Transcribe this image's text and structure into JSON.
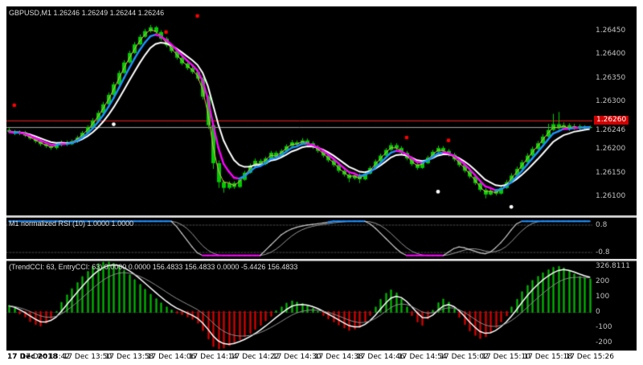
{
  "window": {
    "background": "#FFFFFF"
  },
  "main_chart": {
    "symbol_label": "GBPUSD,M1",
    "ohlc_readout": "1.26246 1.26249 1.26244 1.26246",
    "price_axis_labels": [
      "1.26450",
      "1.26400",
      "1.26350",
      "1.26300",
      "1.26200",
      "1.26150",
      "1.26100"
    ],
    "ask_badge": "1.26260",
    "bid_label": "1.26246"
  },
  "rsi_panel": {
    "label": "M1 normalized RSI (10) 1.0000 1.0000",
    "axis_labels": [
      "0.8",
      "-0.8"
    ]
  },
  "cci_panel": {
    "label": "(TrendCCI: 63, EntryCCI: 63) 0.0000 0.0000 156.4833 156.4833 0.0000 -5.4426 156.4833",
    "axis_labels": [
      "326.8111",
      "200",
      "100",
      "0",
      "-100",
      "-200"
    ]
  },
  "time_axis_labels": [
    "17 Dec 2018",
    "17 Dec 13:42",
    "17 Dec 13:50",
    "17 Dec 13:58",
    "17 Dec 14:06",
    "17 Dec 14:14",
    "17 Dec 14:22",
    "17 Dec 14:30",
    "17 Dec 14:38",
    "17 Dec 14:46",
    "17 Dec 14:54",
    "17 Dec 15:02",
    "17 Dec 15:10",
    "17 Dec 15:18",
    "17 Dec 15:26"
  ],
  "colors": {
    "background": "#000000",
    "axis_text": "#C0C0C0",
    "candle": "#00CC00",
    "ma_white": "#FFFFFF",
    "ma_trend_up": "#1E90FF",
    "ma_trend_down": "#FF00FF",
    "ma_fast_gold": "#F0B060",
    "red_line": "#FF2020",
    "bid_line": "#AAAAAA",
    "badge_bg": "#D00000",
    "signal_red": "#FF0000",
    "signal_white": "#FFFFFF",
    "rsi_high": "#1E90FF",
    "rsi_low": "#FF00FF",
    "rsi_mid": "#C8C8C8",
    "cci_positive": "#00B000",
    "cci_negative": "#D00000",
    "cci_line_white": "#FFFFFF",
    "cci_line_silver": "#909090"
  },
  "chart_data": [
    {
      "type": "candlestick",
      "title": "GBPUSD,M1",
      "ylim": [
        1.2606,
        1.265
      ],
      "red_line_price": 1.2626,
      "bid_price": 1.26246,
      "current_bar": {
        "open": 1.26246,
        "high": 1.26249,
        "low": 1.26244,
        "close": 1.26246
      },
      "label_indices": [
        7,
        15,
        23,
        31,
        39,
        47,
        55,
        63,
        71,
        79,
        87,
        95,
        103,
        111
      ],
      "signals": {
        "red": [
          {
            "i": 1,
            "price": 1.26292
          },
          {
            "i": 30,
            "price": 1.26446
          },
          {
            "i": 36,
            "price": 1.2648
          },
          {
            "i": 76,
            "price": 1.26224
          },
          {
            "i": 84,
            "price": 1.26218
          }
        ],
        "white": [
          {
            "i": 20,
            "price": 1.26252
          },
          {
            "i": 82,
            "price": 1.2611
          },
          {
            "i": 96,
            "price": 1.26078
          }
        ]
      },
      "ohlc": [
        [
          1.2624,
          1.26244,
          1.26233,
          1.26236
        ],
        [
          1.26236,
          1.2624,
          1.26229,
          1.26232
        ],
        [
          1.26232,
          1.26239,
          1.26229,
          1.26235
        ],
        [
          1.26235,
          1.26238,
          1.26225,
          1.26228
        ],
        [
          1.26228,
          1.26232,
          1.26219,
          1.26222
        ],
        [
          1.26222,
          1.26226,
          1.26212,
          1.26216
        ],
        [
          1.26216,
          1.2622,
          1.26206,
          1.2621
        ],
        [
          1.2621,
          1.26215,
          1.26202,
          1.26206
        ],
        [
          1.26206,
          1.2621,
          1.26198,
          1.26202
        ],
        [
          1.26202,
          1.26212,
          1.26199,
          1.26208
        ],
        [
          1.26208,
          1.26218,
          1.26205,
          1.26214
        ],
        [
          1.26214,
          1.26218,
          1.26206,
          1.2621
        ],
        [
          1.2621,
          1.2622,
          1.26208,
          1.26216
        ],
        [
          1.26216,
          1.26228,
          1.26213,
          1.26224
        ],
        [
          1.26224,
          1.26238,
          1.26222,
          1.26234
        ],
        [
          1.26234,
          1.2625,
          1.26232,
          1.26246
        ],
        [
          1.26246,
          1.26265,
          1.26244,
          1.2626
        ],
        [
          1.2626,
          1.26281,
          1.26258,
          1.26276
        ],
        [
          1.26276,
          1.26299,
          1.26274,
          1.26294
        ],
        [
          1.26294,
          1.26319,
          1.26292,
          1.26314
        ],
        [
          1.26314,
          1.26341,
          1.26312,
          1.26336
        ],
        [
          1.26336,
          1.26365,
          1.26334,
          1.2636
        ],
        [
          1.2636,
          1.26387,
          1.26358,
          1.26382
        ],
        [
          1.26382,
          1.26407,
          1.2638,
          1.26402
        ],
        [
          1.26402,
          1.26425,
          1.264,
          1.2642
        ],
        [
          1.2642,
          1.26441,
          1.26418,
          1.26436
        ],
        [
          1.26436,
          1.26453,
          1.26434,
          1.26448
        ],
        [
          1.26448,
          1.26461,
          1.26445,
          1.26456
        ],
        [
          1.26456,
          1.26459,
          1.26442,
          1.26446
        ],
        [
          1.26446,
          1.2645,
          1.26428,
          1.26432
        ],
        [
          1.26432,
          1.26436,
          1.26414,
          1.26418
        ],
        [
          1.26418,
          1.26422,
          1.26402,
          1.26406
        ],
        [
          1.26406,
          1.2641,
          1.26388,
          1.26392
        ],
        [
          1.26392,
          1.26396,
          1.26376,
          1.2638
        ],
        [
          1.2638,
          1.26385,
          1.26366,
          1.2637
        ],
        [
          1.2637,
          1.26374,
          1.26358,
          1.26362
        ],
        [
          1.26362,
          1.26366,
          1.26344,
          1.26348
        ],
        [
          1.26348,
          1.26351,
          1.26304,
          1.2631
        ],
        [
          1.2631,
          1.26313,
          1.26242,
          1.2625
        ],
        [
          1.2625,
          1.26254,
          1.26158,
          1.2617
        ],
        [
          1.2617,
          1.26176,
          1.26118,
          1.2613
        ],
        [
          1.2613,
          1.26134,
          1.26108,
          1.26118
        ],
        [
          1.26118,
          1.26132,
          1.26115,
          1.26128
        ],
        [
          1.26128,
          1.26132,
          1.26116,
          1.2612
        ],
        [
          1.2612,
          1.26139,
          1.26118,
          1.26135
        ],
        [
          1.26135,
          1.26154,
          1.26133,
          1.2615
        ],
        [
          1.2615,
          1.26169,
          1.26148,
          1.26165
        ],
        [
          1.26165,
          1.2618,
          1.26162,
          1.26175
        ],
        [
          1.26175,
          1.26179,
          1.26164,
          1.26168
        ],
        [
          1.26168,
          1.26184,
          1.26166,
          1.2618
        ],
        [
          1.2618,
          1.26196,
          1.26178,
          1.26192
        ],
        [
          1.26192,
          1.26196,
          1.2618,
          1.26184
        ],
        [
          1.26184,
          1.262,
          1.26182,
          1.26196
        ],
        [
          1.26196,
          1.2621,
          1.26194,
          1.26206
        ],
        [
          1.26206,
          1.26219,
          1.26204,
          1.26214
        ],
        [
          1.26214,
          1.26218,
          1.26206,
          1.2621
        ],
        [
          1.2621,
          1.26223,
          1.26208,
          1.26218
        ],
        [
          1.26218,
          1.26222,
          1.26208,
          1.26212
        ],
        [
          1.26212,
          1.26216,
          1.262,
          1.26204
        ],
        [
          1.26204,
          1.26208,
          1.26192,
          1.26196
        ],
        [
          1.26196,
          1.262,
          1.26182,
          1.26186
        ],
        [
          1.26186,
          1.2619,
          1.26172,
          1.26176
        ],
        [
          1.26176,
          1.2618,
          1.26162,
          1.26166
        ],
        [
          1.26166,
          1.2617,
          1.2615,
          1.26154
        ],
        [
          1.26154,
          1.26158,
          1.26142,
          1.26146
        ],
        [
          1.26146,
          1.2615,
          1.2613,
          1.26138
        ],
        [
          1.26138,
          1.26149,
          1.26135,
          1.26144
        ],
        [
          1.26144,
          1.26148,
          1.26128,
          1.26136
        ],
        [
          1.26136,
          1.26152,
          1.26134,
          1.26148
        ],
        [
          1.26148,
          1.26164,
          1.26146,
          1.2616
        ],
        [
          1.2616,
          1.26178,
          1.26158,
          1.26174
        ],
        [
          1.26174,
          1.2619,
          1.26172,
          1.26186
        ],
        [
          1.26186,
          1.26202,
          1.26184,
          1.26198
        ],
        [
          1.26198,
          1.26213,
          1.26196,
          1.26208
        ],
        [
          1.26208,
          1.26212,
          1.26198,
          1.26202
        ],
        [
          1.26202,
          1.26206,
          1.26188,
          1.26192
        ],
        [
          1.26192,
          1.26196,
          1.26176,
          1.2618
        ],
        [
          1.2618,
          1.26184,
          1.26164,
          1.26168
        ],
        [
          1.26168,
          1.26172,
          1.26156,
          1.2616
        ],
        [
          1.2616,
          1.26174,
          1.26158,
          1.2617
        ],
        [
          1.2617,
          1.26186,
          1.26168,
          1.26182
        ],
        [
          1.26182,
          1.26198,
          1.2618,
          1.26194
        ],
        [
          1.26194,
          1.26207,
          1.26192,
          1.26202
        ],
        [
          1.26202,
          1.26206,
          1.26192,
          1.26196
        ],
        [
          1.26196,
          1.262,
          1.26184,
          1.26188
        ],
        [
          1.26188,
          1.26192,
          1.26174,
          1.26178
        ],
        [
          1.26178,
          1.26182,
          1.26162,
          1.26166
        ],
        [
          1.26166,
          1.2617,
          1.2615,
          1.26154
        ],
        [
          1.26154,
          1.26158,
          1.26138,
          1.26142
        ],
        [
          1.26142,
          1.26146,
          1.26124,
          1.26128
        ],
        [
          1.26128,
          1.26132,
          1.2611,
          1.26114
        ],
        [
          1.26114,
          1.26118,
          1.26096,
          1.26104
        ],
        [
          1.26104,
          1.26117,
          1.26102,
          1.26112
        ],
        [
          1.26112,
          1.26116,
          1.26102,
          1.26106
        ],
        [
          1.26106,
          1.26122,
          1.26104,
          1.26118
        ],
        [
          1.26118,
          1.26135,
          1.26116,
          1.2613
        ],
        [
          1.2613,
          1.26149,
          1.26128,
          1.26144
        ],
        [
          1.26144,
          1.26163,
          1.26142,
          1.26158
        ],
        [
          1.26158,
          1.26177,
          1.26156,
          1.26172
        ],
        [
          1.26172,
          1.26191,
          1.2617,
          1.26186
        ],
        [
          1.26186,
          1.26205,
          1.26184,
          1.262
        ],
        [
          1.262,
          1.26217,
          1.26198,
          1.26212
        ],
        [
          1.26212,
          1.26231,
          1.2621,
          1.26226
        ],
        [
          1.26226,
          1.26253,
          1.26224,
          1.2624
        ],
        [
          1.2624,
          1.26274,
          1.26238,
          1.26252
        ],
        [
          1.26252,
          1.26278,
          1.2624,
          1.26244
        ],
        [
          1.26244,
          1.26256,
          1.2624,
          1.2625
        ],
        [
          1.2625,
          1.26254,
          1.26238,
          1.26242
        ],
        [
          1.26242,
          1.26253,
          1.2624,
          1.26248
        ],
        [
          1.26248,
          1.26252,
          1.26239,
          1.26244
        ],
        [
          1.26244,
          1.2625,
          1.26241,
          1.26247
        ],
        [
          1.26246,
          1.26249,
          1.26244,
          1.26246
        ]
      ]
    },
    {
      "type": "line",
      "name": "M1 normalized RSI (10)",
      "ylim": [
        -1.2,
        1.2
      ],
      "levels": [
        0.8,
        -0.8
      ],
      "values": [
        1,
        1,
        1,
        1,
        1,
        1,
        1,
        1,
        1,
        1,
        1,
        1,
        1,
        1,
        1,
        1,
        1,
        1,
        1,
        1,
        1,
        1,
        1,
        1,
        1,
        1,
        1,
        1,
        1,
        1,
        1,
        1,
        0.7,
        0.3,
        -0.1,
        -0.5,
        -0.85,
        -1,
        -1,
        -1,
        -1,
        -1,
        -1,
        -1,
        -1,
        -1,
        -1,
        -1,
        -1,
        -0.7,
        -0.4,
        -0.1,
        0.2,
        0.4,
        0.55,
        0.65,
        0.72,
        0.78,
        0.82,
        0.86,
        0.9,
        0.95,
        1,
        1,
        1,
        1,
        1,
        1,
        1,
        0.85,
        0.6,
        0.3,
        0,
        -0.3,
        -0.6,
        -0.85,
        -1,
        -1,
        -1,
        -1,
        -1,
        -1,
        -1,
        -1,
        -0.8,
        -0.6,
        -0.5,
        -0.55,
        -0.65,
        -0.75,
        -0.85,
        -0.9,
        -0.8,
        -0.55,
        -0.25,
        0.1,
        0.5,
        0.85,
        1,
        1,
        1,
        1,
        1,
        1,
        1,
        1,
        1,
        1,
        1,
        1,
        1,
        1
      ]
    },
    {
      "type": "bar",
      "name": "TrendCCI / EntryCCI histogram",
      "ylim": [
        -255,
        335
      ],
      "axis_max": 326.8111,
      "values": [
        40,
        20,
        -10,
        -30,
        -60,
        -80,
        -90,
        -70,
        -40,
        0,
        60,
        110,
        150,
        190,
        230,
        265,
        295,
        315,
        326,
        326.8,
        318,
        300,
        272,
        242,
        210,
        178,
        146,
        114,
        84,
        56,
        30,
        10,
        -5,
        -15,
        -30,
        -45,
        -70,
        -120,
        -175,
        -225,
        -241,
        -235,
        -220,
        -200,
        -180,
        -160,
        -138,
        -112,
        -85,
        -55,
        -25,
        5,
        30,
        55,
        70,
        62,
        52,
        40,
        22,
        2,
        -20,
        -42,
        -62,
        -82,
        -102,
        -118,
        -110,
        -98,
        -60,
        -20,
        30,
        80,
        120,
        142,
        122,
        82,
        30,
        -20,
        -62,
        -85,
        -42,
        8,
        58,
        82,
        62,
        18,
        -32,
        -80,
        -122,
        -152,
        -172,
        -160,
        -132,
        -100,
        -62,
        -22,
        30,
        80,
        130,
        172,
        205,
        232,
        256,
        276,
        292,
        298,
        288,
        268,
        248,
        232,
        222,
        215
      ]
    }
  ]
}
